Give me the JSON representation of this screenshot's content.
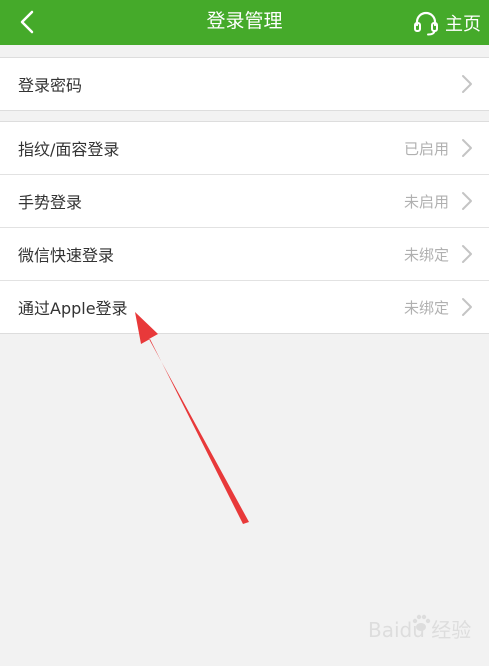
{
  "header": {
    "title": "登录管理",
    "home_label": "主页"
  },
  "group1": [
    {
      "label": "登录密码",
      "status": ""
    }
  ],
  "group2": [
    {
      "label": "指纹/面容登录",
      "status": "已启用"
    },
    {
      "label": "手势登录",
      "status": "未启用"
    },
    {
      "label": "微信快速登录",
      "status": "未绑定"
    },
    {
      "label": "通过Apple登录",
      "status": "未绑定"
    }
  ],
  "watermark": "Baidu 经验",
  "colors": {
    "header_bg": "#45aa2a",
    "annotation_arrow": "#e8393a"
  }
}
